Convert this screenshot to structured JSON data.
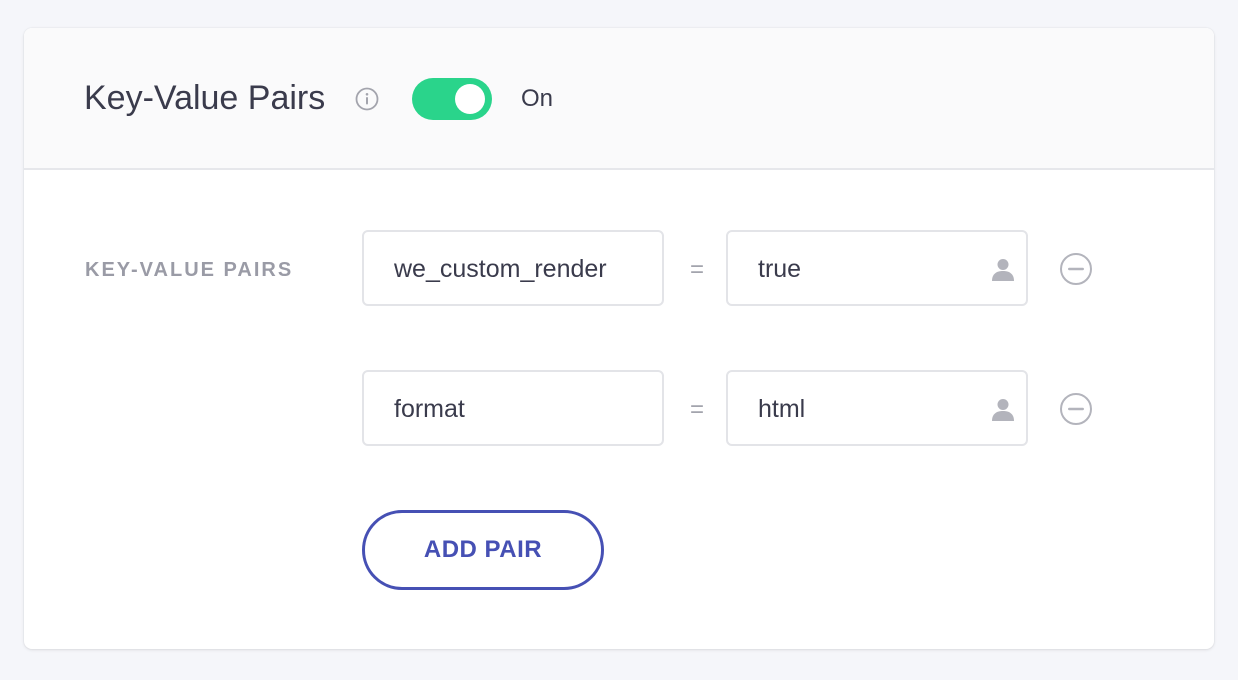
{
  "header": {
    "title": "Key-Value Pairs",
    "info_icon": "info-circle-icon",
    "toggle": {
      "state_label": "On",
      "checked": true,
      "color": "#2ad48b"
    }
  },
  "form": {
    "label": "KEY-VALUE PAIRS",
    "separator": "=",
    "pairs": [
      {
        "key": "we_custom_render",
        "value": "true"
      },
      {
        "key": "format",
        "value": "html"
      }
    ],
    "value_icon": "person-icon",
    "remove_icon": "minus-circle-icon",
    "add_button_label": "ADD PAIR",
    "accent_color": "#4650b4"
  }
}
